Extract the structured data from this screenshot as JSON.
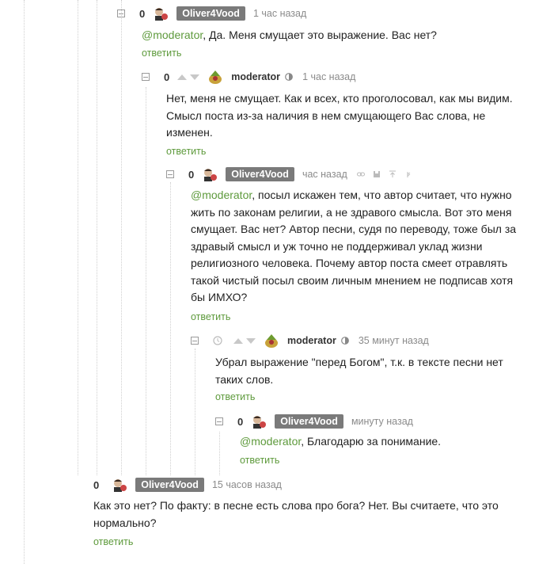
{
  "comments": [
    {
      "rating": "0",
      "nick": "Oliver4Vood",
      "time": "1 час назад",
      "mention": "@moderator",
      "body_line1": ", Да. Меня смущает это выражение. Вас нет?",
      "reply": "ответить"
    },
    {
      "rating": "0",
      "nick": "moderator",
      "time": "1 час назад",
      "body_lines": [
        "Нет, меня не смущает. Как и всех, кто проголосовал, как мы видим.",
        "Смысл поста из-за наличия в нем смущающего Вас слова, не",
        "изменен."
      ],
      "reply": "ответить"
    },
    {
      "rating": "0",
      "nick": "Oliver4Vood",
      "time": "час назад",
      "mention": "@moderator",
      "body_line1": ", посыл искажен тем, что автор считает, что нужно",
      "body_lines": [
        "жить по законам религии, а не здравого смысла. Вот это меня",
        "смущает. Вас нет? Автор песни, судя по переводу, тоже был за",
        "здравый смысл и уж точно не поддерживал уклад жизни",
        "религиозного человека. Почему автор поста смеет отравлять",
        "такой чистый посыл своим личным мнением не подписав хотя",
        "бы ИМХО?"
      ],
      "reply": "ответить"
    },
    {
      "nick": "moderator",
      "time": "35 минут назад",
      "body_lines": [
        "Убрал выражение \"перед Богом\", т.к. в тексте песни нет",
        "таких слов."
      ],
      "reply": "ответить"
    },
    {
      "rating": "0",
      "nick": "Oliver4Vood",
      "time": "минуту назад",
      "mention": "@moderator",
      "body_line1": ", Благодарю за понимание.",
      "reply": "ответить"
    },
    {
      "rating": "0",
      "nick": "Oliver4Vood",
      "time": "15 часов назад",
      "body_lines": [
        "Как это нет? По факту: в песне есть слова про бога? Нет. Вы считаете, что это",
        "нормально?"
      ],
      "reply": "ответить"
    }
  ],
  "colors": {
    "accent": "#5e9a3c",
    "badge": "#7a7a7a",
    "muted": "#8b8b8b"
  },
  "icons": [
    "collapse-toggle-icon",
    "upvote-icon",
    "downvote-icon",
    "avatar-icon",
    "moderator-shield-icon",
    "clock-icon",
    "link-icon",
    "save-icon",
    "pin-icon",
    "share-icon"
  ]
}
